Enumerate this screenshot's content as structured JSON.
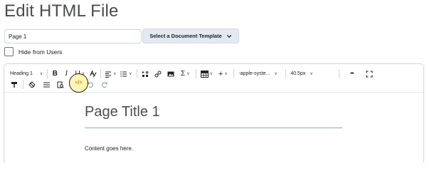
{
  "header": {
    "title": "Edit HTML File"
  },
  "form": {
    "title_value": "Page 1",
    "template_button_label": "Select a Document Template",
    "hide_label": "Hide from Users"
  },
  "toolbar": {
    "heading_select": "Heading 1",
    "font_family_select": "-apple-syste...",
    "font_size_select": "40.5px",
    "bold": "B",
    "italic": "I",
    "underline": "U",
    "sigma": "Σ",
    "plus": "+",
    "more": "•••",
    "source_code": "</>"
  },
  "document": {
    "title": "Page Title 1",
    "content": "Content goes here."
  }
}
